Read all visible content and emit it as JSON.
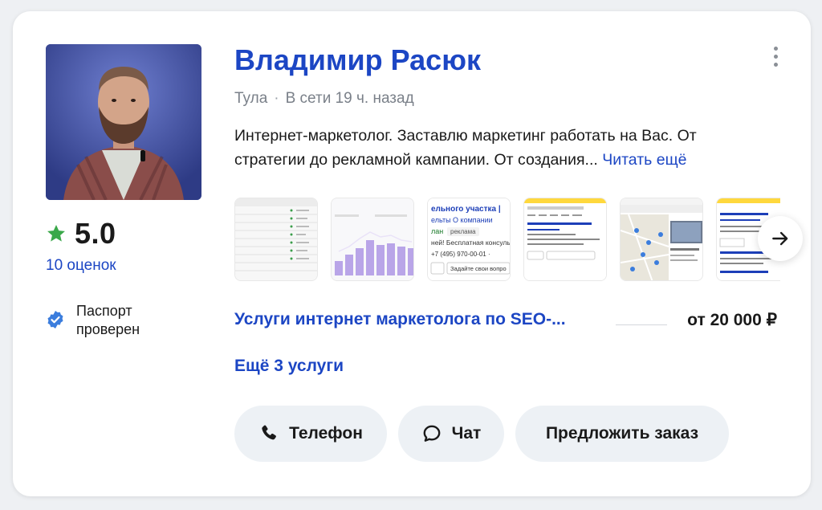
{
  "profile": {
    "name": "Владимир Расюк",
    "city": "Тула",
    "separator": "·",
    "online_status": "В сети 19 ч. назад",
    "description": "Интернет-маркетолог. Заставлю маркетинг работать на Вас. От стратегии до рекламной кампании. От создания...",
    "read_more": "Читать ещё",
    "rating": "5.0",
    "reviews": "10 оценок",
    "passport": "Паспорт проверен"
  },
  "gallery": {
    "thumbnails": [
      {
        "kind": "table-screenshot"
      },
      {
        "kind": "bar-chart-screenshot"
      },
      {
        "kind": "ad-screenshot",
        "line1": "ельного участка | ·",
        "line2": "ельты   О компании",
        "line3": "лан ·   реклама",
        "line4": "ней! Бесплатная консуль",
        "line5": "+7 (495) 970-00-01 · r",
        "line6": "Задайте свои вопро"
      },
      {
        "kind": "search-screenshot"
      },
      {
        "kind": "map-screenshot"
      },
      {
        "kind": "ad-screenshot-2"
      }
    ]
  },
  "service": {
    "title": "Услуги интернет маркетолога по SEO-...",
    "price": "от 20 000 ₽"
  },
  "more_services": "Ещё 3 услуги",
  "actions": {
    "phone": "Телефон",
    "chat": "Чат",
    "order": "Предложить заказ"
  },
  "colors": {
    "link": "#1c46c4",
    "star": "#3aa84a",
    "badge": "#3b7ddd",
    "button_bg": "#edf1f5"
  },
  "icons": [
    "star-icon",
    "verified-badge-icon",
    "more-menu-icon",
    "arrow-right-icon",
    "phone-icon",
    "chat-icon"
  ]
}
